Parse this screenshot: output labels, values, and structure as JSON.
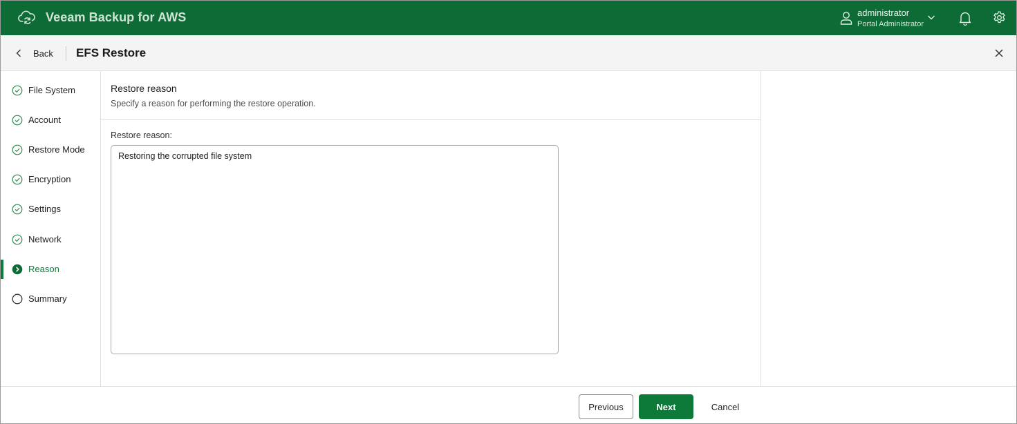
{
  "app": {
    "title": "Veeam Backup for AWS",
    "user_name": "administrator",
    "user_role": "Portal Administrator"
  },
  "header": {
    "back_label": "Back",
    "page_title": "EFS Restore"
  },
  "steps": [
    {
      "label": "File System",
      "state": "completed"
    },
    {
      "label": "Account",
      "state": "completed"
    },
    {
      "label": "Restore Mode",
      "state": "completed"
    },
    {
      "label": "Encryption",
      "state": "completed"
    },
    {
      "label": "Settings",
      "state": "completed"
    },
    {
      "label": "Network",
      "state": "completed"
    },
    {
      "label": "Reason",
      "state": "active"
    },
    {
      "label": "Summary",
      "state": "pending"
    }
  ],
  "main": {
    "section_title": "Restore reason",
    "section_description": "Specify a reason for performing the restore operation.",
    "field_label": "Restore reason:",
    "field_value": "Restoring the corrupted file system"
  },
  "footer": {
    "previous_label": "Previous",
    "next_label": "Next",
    "cancel_label": "Cancel"
  },
  "colors": {
    "brand_green": "#0d6b36",
    "accent_green": "#0d7a3a"
  },
  "icons": {
    "logo": "cloud-sync-icon",
    "user": "user-icon",
    "notifications": "bell-icon",
    "settings": "gear-icon",
    "back": "chevron-left-icon",
    "close": "close-icon",
    "step_completed": "check-circle-icon",
    "step_active": "arrow-right-circle-icon",
    "step_pending": "empty-circle-icon"
  }
}
